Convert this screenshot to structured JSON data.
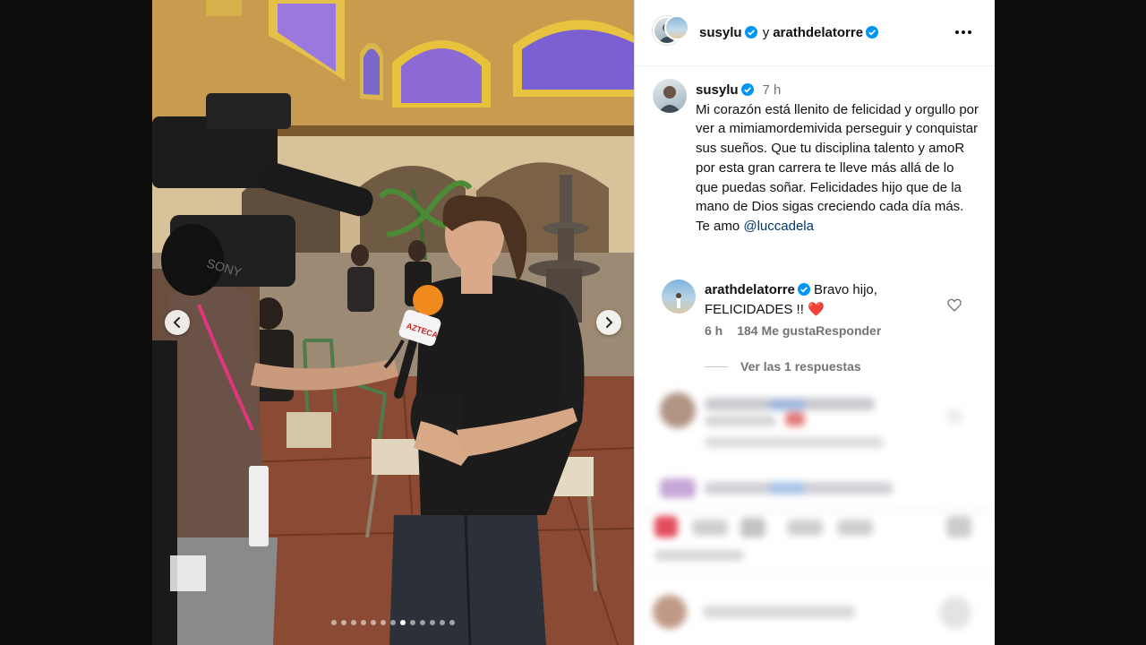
{
  "post": {
    "author": "susylu",
    "coauthor": "arathdelatorre",
    "joiner": "y"
  },
  "caption": {
    "username": "susylu",
    "time": "7 h",
    "text": "Mi corazón está llenito de felicidad y orgullo por ver a mimiamordemivida perseguir y conquistar sus sueños. Que tu disciplina talento y amoR por esta gran carrera te lleve más allá de lo que puedas soñar. Felicidades hijo que de la mano de Dios sigas creciendo cada día más. Te amo ",
    "mention": "@luccadela"
  },
  "comment": {
    "username": "arathdelatorre",
    "text": "Bravo hijo, FELICIDADES !! ❤️",
    "time": "6 h",
    "likes": "184 Me gusta",
    "reply_label": "Responder",
    "view_replies": "Ver las 1 respuestas"
  },
  "carousel": {
    "dot_count": 13,
    "active_index": 7
  },
  "mic_logo": "AZTECA",
  "colors": {
    "verified": "#0095f6",
    "text": "#111111",
    "secondary": "#737373",
    "mention": "#00376b",
    "heart": "#ed4956"
  },
  "icons": [
    "verified-icon",
    "more-icon",
    "heart-icon",
    "chevron-left-icon",
    "chevron-right-icon"
  ]
}
